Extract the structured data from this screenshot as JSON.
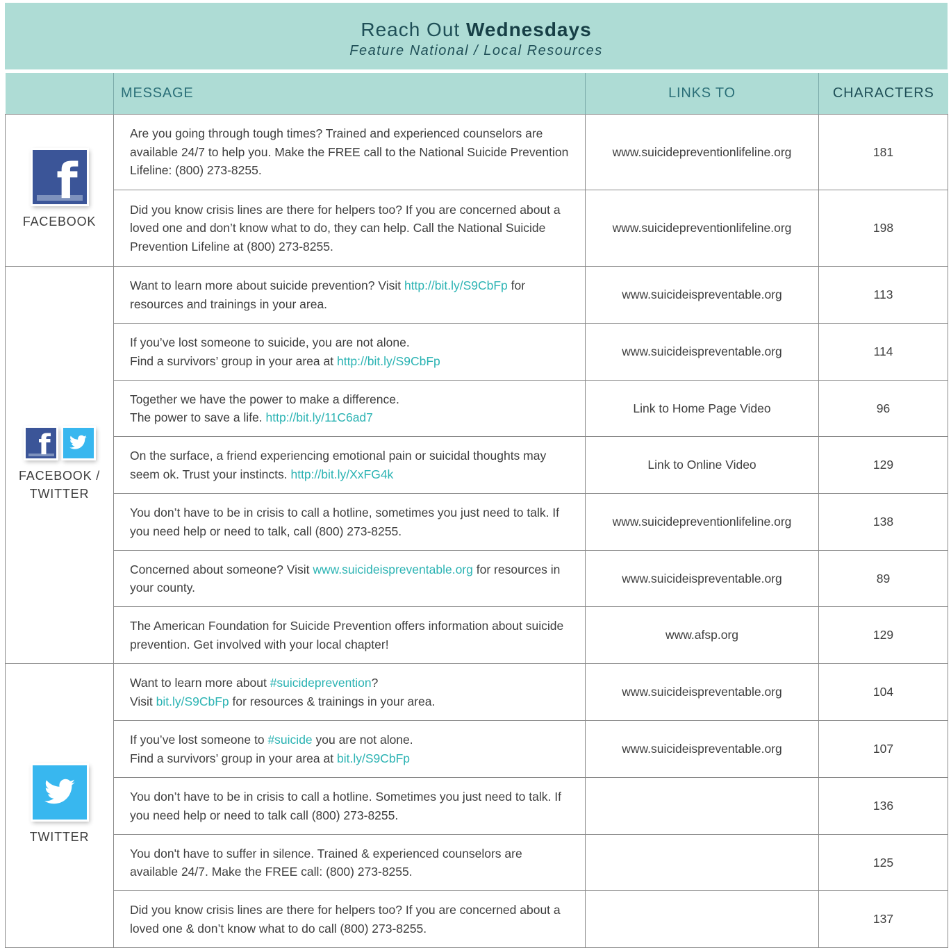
{
  "header": {
    "title_part1": "Reach Out",
    "title_part2": "Wednesdays",
    "subtitle": "Feature National / Local Resources"
  },
  "columns": {
    "message": "MESSAGE",
    "links_to": "LINKS TO",
    "characters": "CHARACTERS"
  },
  "sections": {
    "facebook": {
      "label": "FACEBOOK",
      "icons": [
        "facebook-icon"
      ],
      "rows": [
        {
          "parts": [
            {
              "t": "Are you going through tough times? Trained and experienced counselors are available 24/7 to help you. Make the FREE call to the National Suicide Prevention Lifeline: (800) 273-8255.",
              "link": false
            }
          ],
          "links_to": "www.suicidepreventionlifeline.org",
          "characters": "181"
        },
        {
          "parts": [
            {
              "t": "Did you know crisis lines are there for helpers too? If you are concerned about a loved one and don’t know what to do, they can help. Call the National Suicide Prevention Lifeline at (800) 273-8255.",
              "link": false
            }
          ],
          "links_to": "www.suicidepreventionlifeline.org",
          "characters": "198"
        }
      ]
    },
    "facebook_twitter": {
      "label": "FACEBOOK / TWITTER",
      "icons": [
        "facebook-icon",
        "twitter-icon"
      ],
      "rows": [
        {
          "parts": [
            {
              "t": "Want to learn more about suicide prevention? Visit ",
              "link": false
            },
            {
              "t": "http://bit.ly/S9CbFp",
              "link": true
            },
            {
              "t": " for resources and trainings in your area.",
              "link": false
            }
          ],
          "links_to": "www.suicideispreventable.org",
          "characters": "113"
        },
        {
          "parts": [
            {
              "t": "If you’ve lost someone to suicide, you are not alone.",
              "link": false
            },
            {
              "t": "\n",
              "link": false
            },
            {
              "t": "Find a survivors’ group in your area at ",
              "link": false
            },
            {
              "t": "http://bit.ly/S9CbFp",
              "link": true
            }
          ],
          "links_to": "www.suicideispreventable.org",
          "characters": "114"
        },
        {
          "parts": [
            {
              "t": "Together we have the power to make a difference.",
              "link": false
            },
            {
              "t": "\n",
              "link": false
            },
            {
              "t": "The power to save a life. ",
              "link": false
            },
            {
              "t": "http://bit.ly/11C6ad7",
              "link": true
            }
          ],
          "links_to": "Link to Home Page Video",
          "characters": "96"
        },
        {
          "parts": [
            {
              "t": "On the surface, a friend experiencing emotional pain or suicidal thoughts may seem ok. Trust your instincts. ",
              "link": false
            },
            {
              "t": "http://bit.ly/XxFG4k",
              "link": true
            }
          ],
          "links_to": "Link to Online Video",
          "characters": "129"
        },
        {
          "parts": [
            {
              "t": "You don’t have to be in crisis to call a hotline, sometimes you just need to talk. If you need help or need to talk, call (800) 273-8255.",
              "link": false
            }
          ],
          "links_to": "www.suicidepreventionlifeline.org",
          "characters": "138"
        },
        {
          "parts": [
            {
              "t": "Concerned about someone? Visit ",
              "link": false
            },
            {
              "t": "www.suicideispreventable.org",
              "link": true
            },
            {
              "t": " for resources in your county.",
              "link": false
            }
          ],
          "links_to": "www.suicideispreventable.org",
          "characters": "89"
        },
        {
          "parts": [
            {
              "t": "The American Foundation for Suicide Prevention offers information about suicide prevention. Get involved with your local chapter!",
              "link": false
            }
          ],
          "links_to": "www.afsp.org",
          "characters": "129"
        }
      ]
    },
    "twitter": {
      "label": "TWITTER",
      "icons": [
        "twitter-icon"
      ],
      "rows": [
        {
          "parts": [
            {
              "t": "Want to learn more about ",
              "link": false
            },
            {
              "t": "#suicideprevention",
              "link": true
            },
            {
              "t": "?",
              "link": false
            },
            {
              "t": "\n",
              "link": false
            },
            {
              "t": "Visit ",
              "link": false
            },
            {
              "t": "bit.ly/S9CbFp",
              "link": true
            },
            {
              "t": " for resources & trainings in your area.",
              "link": false
            }
          ],
          "links_to": "www.suicideispreventable.org",
          "characters": "104"
        },
        {
          "parts": [
            {
              "t": "If you’ve lost someone to ",
              "link": false
            },
            {
              "t": "#suicide",
              "link": true
            },
            {
              "t": " you are not alone.",
              "link": false
            },
            {
              "t": "\n",
              "link": false
            },
            {
              "t": "Find a survivors’ group in your area at ",
              "link": false
            },
            {
              "t": "bit.ly/S9CbFp",
              "link": true
            }
          ],
          "links_to": "www.suicideispreventable.org",
          "characters": "107"
        },
        {
          "parts": [
            {
              "t": "You don’t have to be in crisis to call a hotline. Sometimes you just need to talk. If you need help or need to talk call (800) 273-8255.",
              "link": false
            }
          ],
          "links_to": "",
          "characters": "136"
        },
        {
          "parts": [
            {
              "t": "You don't have to suffer in silence. Trained & experienced counselors are available 24/7. Make the FREE call: (800) 273-8255.",
              "link": false
            }
          ],
          "links_to": "",
          "characters": "125"
        },
        {
          "parts": [
            {
              "t": "Did you know crisis lines are there for helpers too? If you are concerned about a loved one & don’t know what to do call (800) 273-8255.",
              "link": false
            }
          ],
          "links_to": "",
          "characters": "137"
        }
      ]
    }
  },
  "colors": {
    "header_bg": "#aedcd5",
    "link": "#2bb3b3",
    "facebook_blue": "#3b5598",
    "twitter_blue": "#38b7ef"
  }
}
